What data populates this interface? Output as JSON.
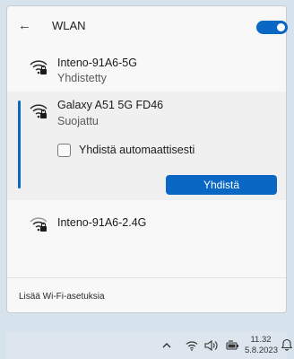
{
  "header": {
    "title": "WLAN",
    "wifi_enabled": true
  },
  "networks": [
    {
      "name": "Inteno-91A6-5G",
      "status": "Yhdistetty",
      "secured": true
    },
    {
      "name": "Galaxy A51 5G FD46",
      "status": "Suojattu",
      "secured": true,
      "auto_connect_label": "Yhdistä automaattisesti",
      "auto_connect_checked": false,
      "connect_label": "Yhdistä"
    },
    {
      "name": "Inteno-91A6-2.4G",
      "status": "",
      "secured": true
    }
  ],
  "footer": {
    "more_settings": "Lisää Wi-Fi-asetuksia"
  },
  "taskbar": {
    "time": "11.32",
    "date": "5.8.2023",
    "icons": [
      "chevron-up-icon",
      "wifi-icon",
      "volume-icon",
      "battery-icon",
      "notification-icon"
    ]
  },
  "colors": {
    "accent": "#0a67c4",
    "panel": "#f8f8f8",
    "taskbar": "#dde6ee"
  }
}
